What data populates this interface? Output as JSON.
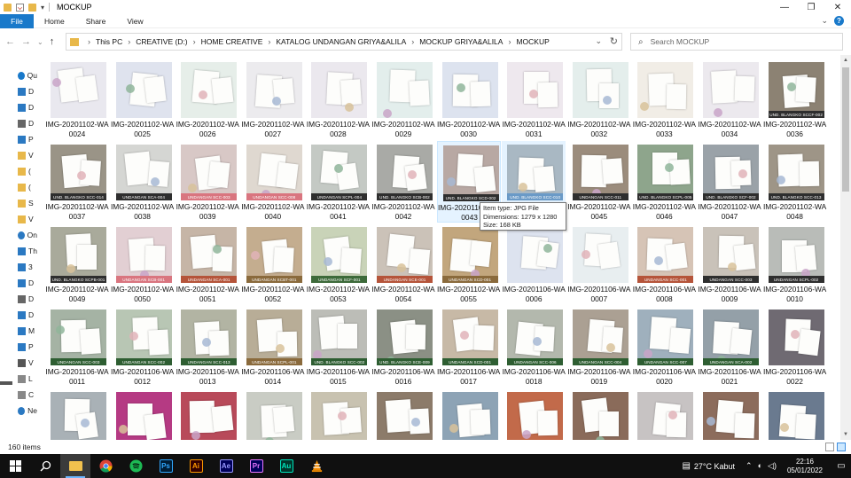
{
  "window": {
    "title": "MOCKUP",
    "controls": {
      "minimize": "—",
      "maximize": "❐",
      "close": "✕"
    }
  },
  "ribbon": {
    "file": "File",
    "tabs": [
      "Home",
      "Share",
      "View"
    ],
    "help": "?"
  },
  "address": {
    "crumbs": [
      "This PC",
      "CREATIVE (D:)",
      "HOME CREATIVE",
      "KATALOG UNDANGAN GRIYA&ALILA",
      "MOCKUP GRIYA&ALILA",
      "MOCKUP"
    ]
  },
  "search": {
    "placeholder": "Search MOCKUP"
  },
  "nav_pane": {
    "items": [
      {
        "label": "Qu",
        "icon": "star-icon"
      },
      {
        "label": "D",
        "icon": "desktop-icon"
      },
      {
        "label": "D",
        "icon": "download-icon"
      },
      {
        "label": "D",
        "icon": "document-icon"
      },
      {
        "label": "P",
        "icon": "picture-icon"
      },
      {
        "label": "V",
        "icon": "folder-icon"
      },
      {
        "label": "(",
        "icon": "folder-icon"
      },
      {
        "label": "(",
        "icon": "folder-icon"
      },
      {
        "label": "S",
        "icon": "folder-icon"
      },
      {
        "label": "V",
        "icon": "folder-icon"
      },
      {
        "label": "On",
        "icon": "onedrive-icon"
      },
      {
        "label": "Th",
        "icon": "this-pc-icon"
      },
      {
        "label": "3",
        "icon": "cube-icon"
      },
      {
        "label": "D",
        "icon": "desktop-icon"
      },
      {
        "label": "D",
        "icon": "document-icon"
      },
      {
        "label": "D",
        "icon": "download-icon"
      },
      {
        "label": "M",
        "icon": "music-icon"
      },
      {
        "label": "P",
        "icon": "picture-icon"
      },
      {
        "label": "V",
        "icon": "video-icon"
      },
      {
        "label": "L",
        "icon": "drive-icon"
      },
      {
        "label": "C",
        "icon": "drive-icon"
      },
      {
        "label": "Ne",
        "icon": "network-icon"
      }
    ]
  },
  "files": [
    {
      "name": "IMG-20201102-WA0024",
      "band": "",
      "bg": "#e9e8ef"
    },
    {
      "name": "IMG-20201102-WA0025",
      "band": "",
      "bg": "#dfe3ee"
    },
    {
      "name": "IMG-20201102-WA0026",
      "band": "",
      "bg": "#e6eee9"
    },
    {
      "name": "IMG-20201102-WA0027",
      "band": "",
      "bg": "#ecebee"
    },
    {
      "name": "IMG-20201102-WA0028",
      "band": "",
      "bg": "#ebe8ee"
    },
    {
      "name": "IMG-20201102-WA0029",
      "band": "",
      "bg": "#e3eeec"
    },
    {
      "name": "IMG-20201102-WA0030",
      "band": "",
      "bg": "#dde3ef"
    },
    {
      "name": "IMG-20201102-WA0031",
      "band": "",
      "bg": "#eee8ee"
    },
    {
      "name": "IMG-20201102-WA0032",
      "band": "",
      "bg": "#e4eeec"
    },
    {
      "name": "IMG-20201102-WA0033",
      "band": "",
      "bg": "#f1ede6"
    },
    {
      "name": "IMG-20201102-WA0034",
      "band": "",
      "bg": "#ece9ee"
    },
    {
      "name": "IMG-20201102-WA0036",
      "band": "UND. BLANGKO SCCF-002",
      "bg": "#8c8273",
      "bandColor": "#2e2e2e"
    },
    {
      "name": "IMG-20201102-WA0037",
      "band": "UND. BLANGKO SCC-014",
      "bg": "#9a9487",
      "bandColor": "#2e2e2e"
    },
    {
      "name": "IMG-20201102-WA0038",
      "band": "UNDANGAN SCA-004",
      "bg": "#d5d6d3",
      "bandColor": "#2e2e2e"
    },
    {
      "name": "IMG-20201102-WA0039",
      "band": "UNDANGAN SCC-003",
      "bg": "#d8c8c6",
      "bandColor": "#d9757f"
    },
    {
      "name": "IMG-20201102-WA0040",
      "band": "UNDANGAN SCC-008",
      "bg": "#dfd8d0",
      "bandColor": "#d9757f"
    },
    {
      "name": "IMG-20201102-WA0041",
      "band": "UNDANGAN SCPL-004",
      "bg": "#c4c9c4",
      "bandColor": "#2e2e2e"
    },
    {
      "name": "IMG-20201102-WA0042",
      "band": "UND. BLANGKO SCB-002",
      "bg": "#a9aaa6",
      "bandColor": "#2e2e2e"
    },
    {
      "name": "IMG-20201102-WA0043",
      "band": "UND. BLANGKO SCD-002",
      "bg": "#b8a8a3",
      "bandColor": "#2e2e2e"
    },
    {
      "name": "IMG-20201102-WA0044",
      "band": "UND. BLANGKO SCC-010",
      "bg": "#a9b8c3",
      "bandColor": "#6a9ac7"
    },
    {
      "name": "IMG-20201102-WA0045",
      "band": "UNDANGAN SCC-011",
      "bg": "#9b8c7c",
      "bandColor": "#2e2e2e"
    },
    {
      "name": "IMG-20201102-WA0046",
      "band": "UND. BLANGKO SCPL-005",
      "bg": "#8ea58c",
      "bandColor": "#2e2e2e"
    },
    {
      "name": "IMG-20201102-WA0047",
      "band": "UND. BLANGKO SCF-002",
      "bg": "#9aa2a8",
      "bandColor": "#2e2e2e"
    },
    {
      "name": "IMG-20201102-WA0048",
      "band": "UND. BLANGKO SCC-013",
      "bg": "#9e9587",
      "bandColor": "#2e2e2e"
    },
    {
      "name": "IMG-20201102-WA0049",
      "band": "UND. BLANGKO SCPB-001",
      "bg": "#a9aa9b",
      "bandColor": "#2e2e2e"
    },
    {
      "name": "IMG-20201102-WA0050",
      "band": "UNDANGAN SCB-001",
      "bg": "#e2cfd3",
      "bandColor": "#d9757f"
    },
    {
      "name": "IMG-20201102-WA0051",
      "band": "UNDANGAN SCA-001",
      "bg": "#c6b5a6",
      "bandColor": "#b5543a"
    },
    {
      "name": "IMG-20201102-WA0052",
      "band": "UNDANGAN SCBT-001",
      "bg": "#c4ad8f",
      "bandColor": "#8a6a3c"
    },
    {
      "name": "IMG-20201102-WA0053",
      "band": "UNDANGAN SCF-001",
      "bg": "#c9d3b8",
      "bandColor": "#3d6a3a"
    },
    {
      "name": "IMG-20201102-WA0054",
      "band": "UNDANGAN SCE-001",
      "bg": "#cbc2b8",
      "bandColor": "#b5543a"
    },
    {
      "name": "IMG-20201102-WA0055",
      "band": "UNDANGAN SCD-001",
      "bg": "#c2a67d",
      "bandColor": "#8a6a3c"
    },
    {
      "name": "IMG-20201106-WA0006",
      "band": "",
      "bg": "#dde3ef"
    },
    {
      "name": "IMG-20201106-WA0007",
      "band": "",
      "bg": "#e8eef0"
    },
    {
      "name": "IMG-20201106-WA0008",
      "band": "UNDANGAN SCC-001",
      "bg": "#d6c4b6",
      "bandColor": "#b5543a"
    },
    {
      "name": "IMG-20201106-WA0009",
      "band": "UNDANGAN SCC-003",
      "bg": "#c9c2b9",
      "bandColor": "#2e2e2e"
    },
    {
      "name": "IMG-20201106-WA0010",
      "band": "UNDANGAN SCPL-002",
      "bg": "#b9bcb8",
      "bandColor": "#2e2e2e"
    },
    {
      "name": "IMG-20201106-WA0011",
      "band": "UNDANGAN SCC-003",
      "bg": "#a5b3a4",
      "bandColor": "#2e5e32"
    },
    {
      "name": "IMG-20201106-WA0012",
      "band": "UNDANGAN SCC-002",
      "bg": "#b8c6b4",
      "bandColor": "#2e5e32"
    },
    {
      "name": "IMG-20201106-WA0013",
      "band": "UNDANGAN SCC-013",
      "bg": "#b2b4a3",
      "bandColor": "#2e5e32"
    },
    {
      "name": "IMG-20201106-WA0014",
      "band": "UNDANGAN SCPL-001",
      "bg": "#b8ad97",
      "bandColor": "#8a6a3c"
    },
    {
      "name": "IMG-20201106-WA0015",
      "band": "UND. BLANGKO SCC-002",
      "bg": "#bcbdb7",
      "bandColor": "#2e5e32"
    },
    {
      "name": "IMG-20201106-WA0016",
      "band": "UND. BLANGKO SCE-009",
      "bg": "#8b9085",
      "bandColor": "#2e5e32"
    },
    {
      "name": "IMG-20201106-WA0017",
      "band": "UNDANGAN SCD-001",
      "bg": "#c7b9a6",
      "bandColor": "#2e5e32"
    },
    {
      "name": "IMG-20201106-WA0018",
      "band": "UNDANGAN SCC-006",
      "bg": "#b3b8ad",
      "bandColor": "#2e5e32"
    },
    {
      "name": "IMG-20201106-WA0019",
      "band": "UNDANGAN SCC-004",
      "bg": "#aba093",
      "bandColor": "#2e5e32"
    },
    {
      "name": "IMG-20201106-WA0020",
      "band": "UNDANGAN SCC-007",
      "bg": "#9fb0bd",
      "bandColor": "#2e5e32"
    },
    {
      "name": "IMG-20201106-WA0021",
      "band": "UNDANGAN SCA-002",
      "bg": "#94a0a8",
      "bandColor": "#2e5e32"
    },
    {
      "name": "IMG-20201106-WA0022",
      "band": "",
      "bg": "#6f6a72"
    },
    {
      "name": "",
      "band": "",
      "bg": "#a9b1b6"
    },
    {
      "name": "",
      "band": "",
      "bg": "#b53a83"
    },
    {
      "name": "",
      "band": "",
      "bg": "#b84a5a"
    },
    {
      "name": "",
      "band": "",
      "bg": "#c9ccc4"
    },
    {
      "name": "",
      "band": "",
      "bg": "#c8c2b0"
    },
    {
      "name": "",
      "band": "",
      "bg": "#8c7b6a"
    },
    {
      "name": "",
      "band": "",
      "bg": "#8da3b5"
    },
    {
      "name": "",
      "band": "",
      "bg": "#c26a4a"
    },
    {
      "name": "",
      "band": "",
      "bg": "#8a6b5a"
    },
    {
      "name": "",
      "band": "",
      "bg": "#c7c3c3"
    },
    {
      "name": "",
      "band": "",
      "bg": "#8c6c5c"
    },
    {
      "name": "",
      "band": "",
      "bg": "#6a7a8f"
    }
  ],
  "tooltip": {
    "type": "Item type: JPG File",
    "dimensions": "Dimensions: 1279 x 1280",
    "size": "Size: 168 KB"
  },
  "status": {
    "count": "160 items"
  },
  "taskbar": {
    "apps": [
      {
        "name": "start",
        "label": ""
      },
      {
        "name": "search",
        "label": ""
      },
      {
        "name": "file-explorer",
        "label": ""
      },
      {
        "name": "chrome",
        "label": ""
      },
      {
        "name": "spotify",
        "label": ""
      },
      {
        "name": "photoshop",
        "label": "Ps"
      },
      {
        "name": "illustrator",
        "label": "Ai"
      },
      {
        "name": "after-effects",
        "label": "Ae"
      },
      {
        "name": "premiere",
        "label": "Pr"
      },
      {
        "name": "audition",
        "label": "Au"
      },
      {
        "name": "vlc",
        "label": ""
      }
    ],
    "weather": "27°C  Kabut",
    "time": "22:16",
    "date": "05/01/2022"
  },
  "colors": {
    "accent": "#1979ca",
    "taskbar": "#101010",
    "selection": "#e5f3ff"
  }
}
